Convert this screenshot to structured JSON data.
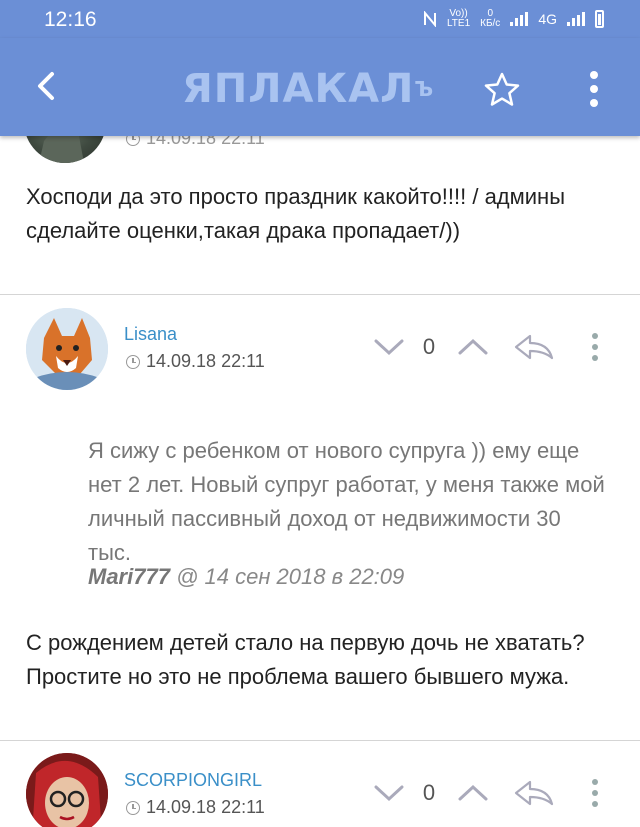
{
  "status_bar": {
    "time": "12:16",
    "volte_top": "Vo))",
    "volte_bottom": "LTE1",
    "speed_value": "0",
    "speed_unit": "КБ/с",
    "network": "4G"
  },
  "app_bar": {
    "logo": "ЯПЛАКАЛ",
    "logo_mark": "Ъ"
  },
  "posts": [
    {
      "date": "14.09.18 22:11",
      "text": "Хосподи да это просто праздник какойто!!!! / админы сделайте оценки,такая драка пропадает/))"
    },
    {
      "author": "Lisana",
      "date": "14.09.18 22:11",
      "votes": "0",
      "quote_text": "Я сижу с ребенком от нового супруга )) ему еще нет 2 лет. Новый супруг работат, у меня также мой личный пассивный доход от недвижимости 30 тыс.",
      "quote_author": "Mari777",
      "quote_meta": "@ 14 сен 2018 в 22:09",
      "text": "С рождением детей стало на первую дочь не хватать? Простите но это не проблема вашего бывшего мужа."
    },
    {
      "author": "SCORPIONGIRL",
      "date": "14.09.18 22:11",
      "votes": "0"
    }
  ],
  "colors": {
    "app_bar": "#6b8fd6",
    "author": "#3a8fc8"
  }
}
